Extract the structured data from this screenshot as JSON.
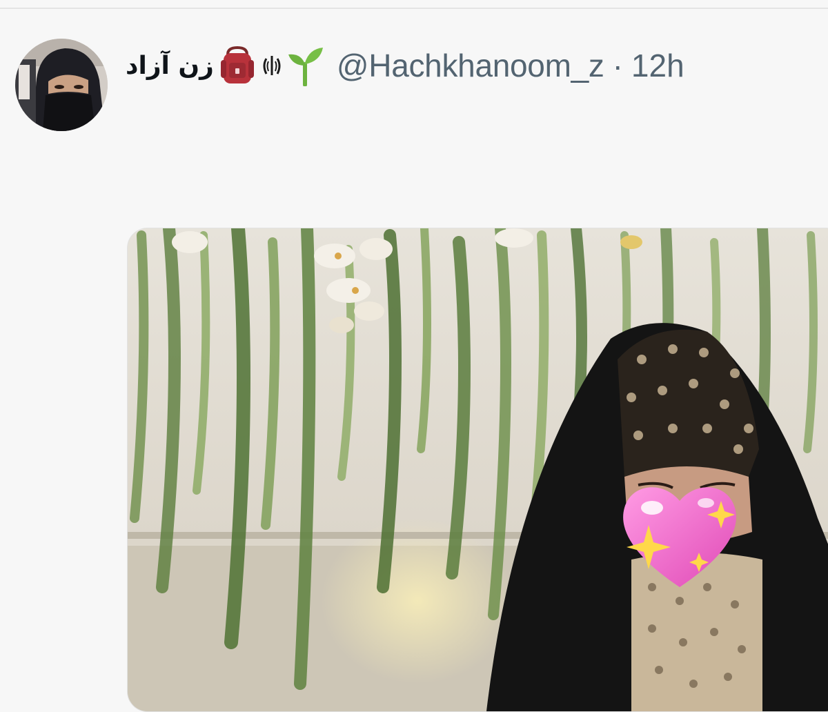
{
  "tweet": {
    "author": {
      "display_name": "زن آزاد",
      "display_emojis": [
        "backpack-emoji",
        "iran-emblem-emoji",
        "seedling-emoji"
      ],
      "handle": "@Hachkhanoom_z",
      "avatar_icon": "avatar-photo"
    },
    "separator": "·",
    "timestamp": "12h",
    "media": {
      "image_icon": "attached-photo",
      "overlay_emoji": "sparkling-heart-emoji"
    }
  },
  "colors": {
    "background": "#f7f7f7",
    "name_text": "#0f1419",
    "secondary_text": "#536471",
    "seedling_green": "#6db33f",
    "backpack_red": "#b8323b",
    "heart_pink": "#f06ac8"
  }
}
